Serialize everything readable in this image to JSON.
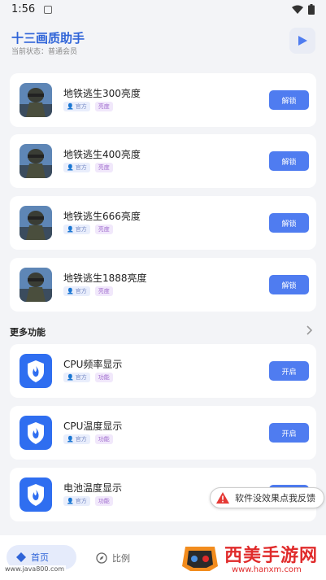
{
  "status": {
    "time": "1:56"
  },
  "header": {
    "title": "十三画质助手",
    "subtitle": "当前状态：普通会员"
  },
  "game_items": [
    {
      "title": "地铁逃生300亮度",
      "tag1": "官方",
      "tag2": "亮度",
      "button": "解锁"
    },
    {
      "title": "地铁逃生400亮度",
      "tag1": "官方",
      "tag2": "亮度",
      "button": "解锁"
    },
    {
      "title": "地铁逃生666亮度",
      "tag1": "官方",
      "tag2": "亮度",
      "button": "解锁"
    },
    {
      "title": "地铁逃生1888亮度",
      "tag1": "官方",
      "tag2": "亮度",
      "button": "解锁"
    }
  ],
  "section": {
    "title": "更多功能"
  },
  "feature_items": [
    {
      "title": "CPU频率显示",
      "tag1": "官方",
      "tag2": "功能",
      "button": "开启"
    },
    {
      "title": "CPU温度显示",
      "tag1": "官方",
      "tag2": "功能",
      "button": "开启"
    },
    {
      "title": "电池温度显示",
      "tag1": "官方",
      "tag2": "功能",
      "button": "开启"
    }
  ],
  "toast": {
    "text": "软件没效果点我反馈"
  },
  "nav": {
    "home": "首页",
    "ratio": "比例"
  },
  "watermarks": {
    "left": "www.java800.com",
    "brand": "西美手游网",
    "url": "www.hanxm.com"
  },
  "colors": {
    "accent": "#4f7cf0",
    "title": "#2f64d8",
    "background": "#f3f4f7"
  }
}
